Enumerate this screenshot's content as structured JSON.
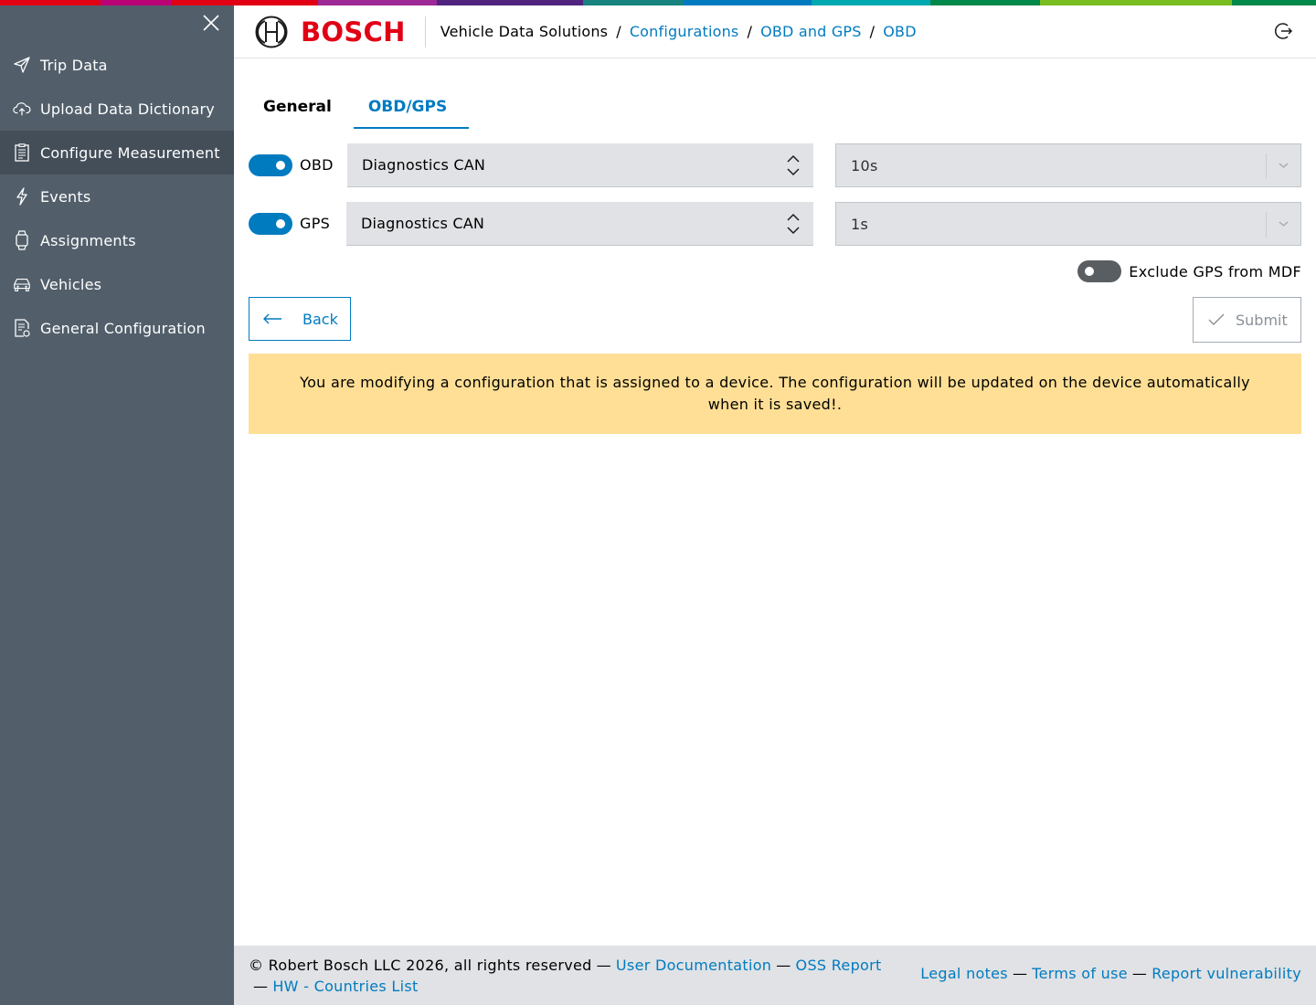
{
  "supergraphic_colors": [
    "#e20015",
    "#b90276",
    "#e20015",
    "#50237f",
    "#18837e",
    "#007bc0",
    "#00a8b0",
    "#00884a",
    "#78be20"
  ],
  "sidebar": {
    "items": [
      {
        "label": "Trip Data",
        "icon": "send-icon"
      },
      {
        "label": "Upload Data Dictionary",
        "icon": "cloud-upload-icon"
      },
      {
        "label": "Configure Measurement",
        "icon": "clipboard-list-icon",
        "active": true
      },
      {
        "label": "Events",
        "icon": "lightning-icon"
      },
      {
        "label": "Assignments",
        "icon": "watch-icon"
      },
      {
        "label": "Vehicles",
        "icon": "car-icon"
      },
      {
        "label": "General Configuration",
        "icon": "document-settings-icon"
      }
    ]
  },
  "header": {
    "logo_text": "BOSCH",
    "breadcrumb": {
      "root": "Vehicle Data Solutions",
      "sep": "/",
      "link1": "Configurations",
      "link2": "OBD and GPS",
      "link3": "OBD"
    }
  },
  "tabs": {
    "general": "General",
    "obd_gps": "OBD/GPS"
  },
  "rows": {
    "obd": {
      "label": "OBD",
      "enabled": true,
      "source": "Diagnostics CAN",
      "interval": "10s"
    },
    "gps": {
      "label": "GPS",
      "enabled": true,
      "source": "Diagnostics CAN",
      "interval": "1s"
    }
  },
  "exclude_gps": {
    "label": "Exclude GPS from MDF",
    "enabled": false
  },
  "buttons": {
    "back": "Back",
    "submit": "Submit"
  },
  "notice": "You are modifying a configuration that is assigned to a device. The configuration will be updated on the device automatically when it is saved!.",
  "footer": {
    "copyright": "© Robert Bosch LLC 2026, all rights reserved",
    "dash": "—",
    "user_docs": "User Documentation",
    "oss_report": "OSS Report",
    "hw_countries": "HW - Countries List",
    "legal": "Legal notes",
    "terms": "Terms of use",
    "vuln": "Report vulnerability"
  },
  "colors": {
    "accent": "#007bc0",
    "brand_red": "#e20015",
    "sidebar_bg": "#525f6b",
    "notice_bg": "#ffdf95"
  }
}
